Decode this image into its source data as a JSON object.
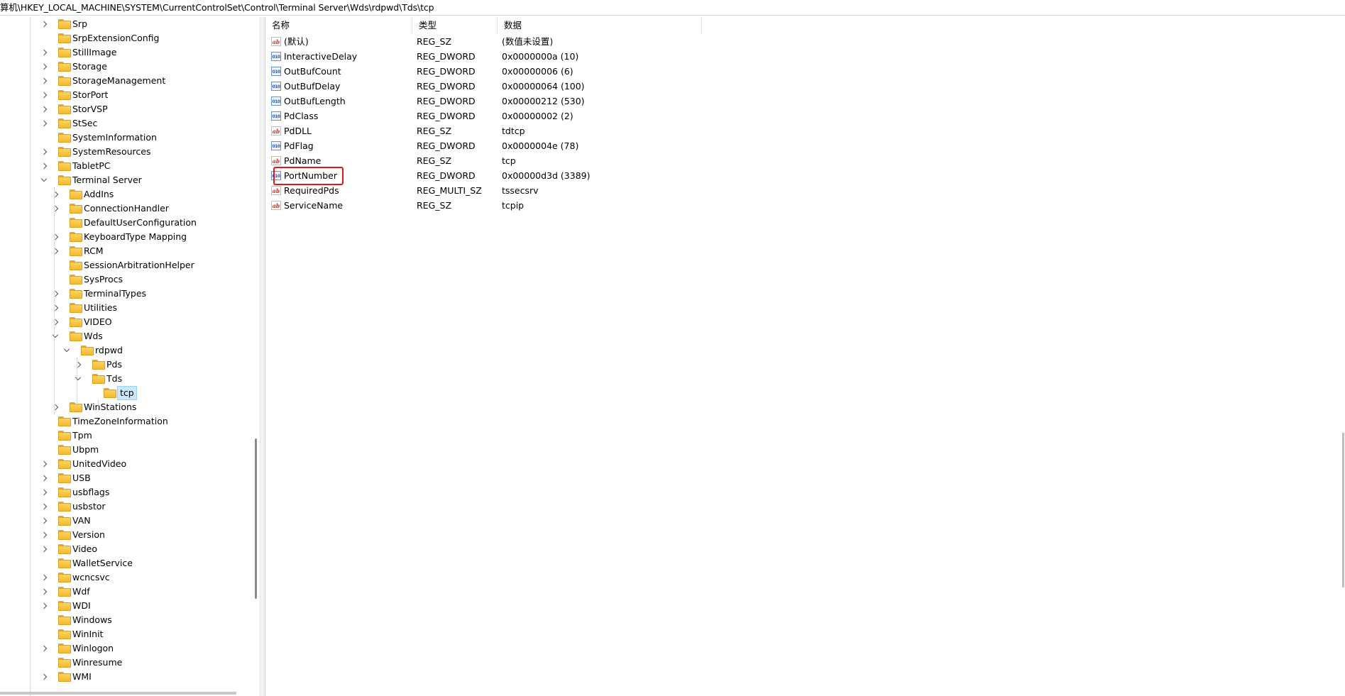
{
  "address_bar": {
    "path": "算机\\HKEY_LOCAL_MACHINE\\SYSTEM\\CurrentControlSet\\Control\\Terminal Server\\Wds\\rdpwd\\Tds\\tcp"
  },
  "tree": [
    {
      "label": "Srp",
      "level": 0,
      "chevron": "right"
    },
    {
      "label": "SrpExtensionConfig",
      "level": 0,
      "chevron": "none"
    },
    {
      "label": "StillImage",
      "level": 0,
      "chevron": "right"
    },
    {
      "label": "Storage",
      "level": 0,
      "chevron": "right"
    },
    {
      "label": "StorageManagement",
      "level": 0,
      "chevron": "right"
    },
    {
      "label": "StorPort",
      "level": 0,
      "chevron": "right"
    },
    {
      "label": "StorVSP",
      "level": 0,
      "chevron": "right"
    },
    {
      "label": "StSec",
      "level": 0,
      "chevron": "right"
    },
    {
      "label": "SystemInformation",
      "level": 0,
      "chevron": "none"
    },
    {
      "label": "SystemResources",
      "level": 0,
      "chevron": "right"
    },
    {
      "label": "TabletPC",
      "level": 0,
      "chevron": "right"
    },
    {
      "label": "Terminal Server",
      "level": 0,
      "chevron": "down"
    },
    {
      "label": "AddIns",
      "level": 1,
      "chevron": "right"
    },
    {
      "label": "ConnectionHandler",
      "level": 1,
      "chevron": "right"
    },
    {
      "label": "DefaultUserConfiguration",
      "level": 1,
      "chevron": "none"
    },
    {
      "label": "KeyboardType Mapping",
      "level": 1,
      "chevron": "right"
    },
    {
      "label": "RCM",
      "level": 1,
      "chevron": "right"
    },
    {
      "label": "SessionArbitrationHelper",
      "level": 1,
      "chevron": "none"
    },
    {
      "label": "SysProcs",
      "level": 1,
      "chevron": "none"
    },
    {
      "label": "TerminalTypes",
      "level": 1,
      "chevron": "right"
    },
    {
      "label": "Utilities",
      "level": 1,
      "chevron": "right"
    },
    {
      "label": "VIDEO",
      "level": 1,
      "chevron": "right"
    },
    {
      "label": "Wds",
      "level": 1,
      "chevron": "down"
    },
    {
      "label": "rdpwd",
      "level": 2,
      "chevron": "down"
    },
    {
      "label": "Pds",
      "level": 3,
      "chevron": "right"
    },
    {
      "label": "Tds",
      "level": 3,
      "chevron": "down"
    },
    {
      "label": "tcp",
      "level": 4,
      "chevron": "none",
      "selected": true
    },
    {
      "label": "WinStations",
      "level": 1,
      "chevron": "right"
    },
    {
      "label": "TimeZoneInformation",
      "level": 0,
      "chevron": "none"
    },
    {
      "label": "Tpm",
      "level": 0,
      "chevron": "none"
    },
    {
      "label": "Ubpm",
      "level": 0,
      "chevron": "none"
    },
    {
      "label": "UnitedVideo",
      "level": 0,
      "chevron": "right"
    },
    {
      "label": "USB",
      "level": 0,
      "chevron": "right"
    },
    {
      "label": "usbflags",
      "level": 0,
      "chevron": "right"
    },
    {
      "label": "usbstor",
      "level": 0,
      "chevron": "right"
    },
    {
      "label": "VAN",
      "level": 0,
      "chevron": "right"
    },
    {
      "label": "Version",
      "level": 0,
      "chevron": "right"
    },
    {
      "label": "Video",
      "level": 0,
      "chevron": "right"
    },
    {
      "label": "WalletService",
      "level": 0,
      "chevron": "none"
    },
    {
      "label": "wcncsvc",
      "level": 0,
      "chevron": "right"
    },
    {
      "label": "Wdf",
      "level": 0,
      "chevron": "right"
    },
    {
      "label": "WDI",
      "level": 0,
      "chevron": "right"
    },
    {
      "label": "Windows",
      "level": 0,
      "chevron": "none"
    },
    {
      "label": "WinInit",
      "level": 0,
      "chevron": "none"
    },
    {
      "label": "Winlogon",
      "level": 0,
      "chevron": "right"
    },
    {
      "label": "Winresume",
      "level": 0,
      "chevron": "none"
    },
    {
      "label": "WMI",
      "level": 0,
      "chevron": "right"
    }
  ],
  "values_table": {
    "columns": [
      "名称",
      "类型",
      "数据"
    ],
    "rows": [
      {
        "icon": "ab",
        "name": "(默认)",
        "type": "REG_SZ",
        "data": "(数值未设置)"
      },
      {
        "icon": "dword",
        "name": "InteractiveDelay",
        "type": "REG_DWORD",
        "data": "0x0000000a (10)"
      },
      {
        "icon": "dword",
        "name": "OutBufCount",
        "type": "REG_DWORD",
        "data": "0x00000006 (6)"
      },
      {
        "icon": "dword",
        "name": "OutBufDelay",
        "type": "REG_DWORD",
        "data": "0x00000064 (100)"
      },
      {
        "icon": "dword",
        "name": "OutBufLength",
        "type": "REG_DWORD",
        "data": "0x00000212 (530)"
      },
      {
        "icon": "dword",
        "name": "PdClass",
        "type": "REG_DWORD",
        "data": "0x00000002 (2)"
      },
      {
        "icon": "ab",
        "name": "PdDLL",
        "type": "REG_SZ",
        "data": "tdtcp"
      },
      {
        "icon": "dword",
        "name": "PdFlag",
        "type": "REG_DWORD",
        "data": "0x0000004e (78)"
      },
      {
        "icon": "ab",
        "name": "PdName",
        "type": "REG_SZ",
        "data": "tcp"
      },
      {
        "icon": "dword",
        "name": "PortNumber",
        "type": "REG_DWORD",
        "data": "0x00000d3d (3389)",
        "highlighted": true
      },
      {
        "icon": "ab",
        "name": "RequiredPds",
        "type": "REG_MULTI_SZ",
        "data": "tssecsrv"
      },
      {
        "icon": "ab",
        "name": "ServiceName",
        "type": "REG_SZ",
        "data": "tcpip"
      }
    ]
  },
  "icons": {
    "string_value": "ab",
    "dword_value": "010",
    "folder": "folder-icon"
  },
  "colors": {
    "selection_bg": "#cce8ff",
    "highlight_box": "#e01818",
    "folder": "#f4b932"
  }
}
